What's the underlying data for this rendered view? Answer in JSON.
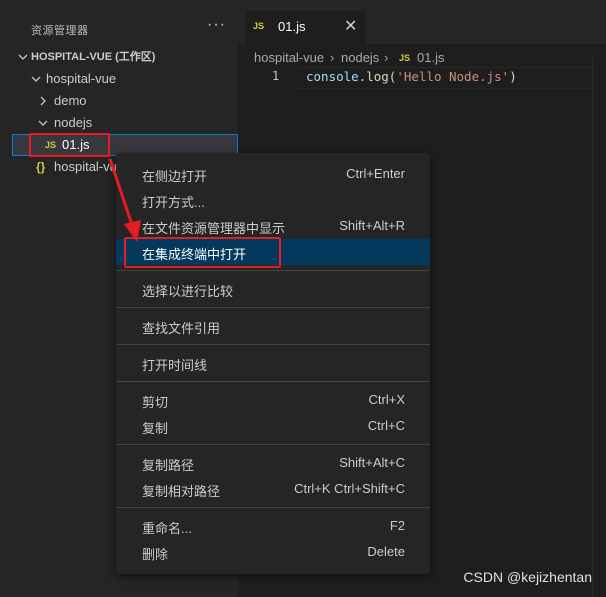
{
  "explorer": {
    "title": "资源管理器",
    "more": "···",
    "tree": [
      {
        "label": "HOSPITAL-VUE (工作区)",
        "chevron": "expanded"
      },
      {
        "label": "hospital-vue",
        "chevron": "expanded"
      },
      {
        "label": "demo",
        "chevron": "collapsed"
      },
      {
        "label": "nodejs",
        "chevron": "expanded"
      },
      {
        "label": "01.js",
        "icon_text": "JS",
        "selected": true
      },
      {
        "label": "hospital-vue.code-workspace",
        "icon_text": "{}"
      }
    ]
  },
  "editor": {
    "tab": {
      "icon_text": "JS",
      "label": "01.js",
      "close": "✕"
    },
    "breadcrumb": [
      "hospital-vue",
      "nodejs",
      "01.js"
    ],
    "breadcrumb_sep": "›",
    "breadcrumb_icon": "JS",
    "line_number": "1",
    "code_tokens": [
      "console",
      ".",
      "log",
      "(",
      "'Hello Node.js'",
      ")"
    ]
  },
  "context_menu": {
    "items": [
      {
        "label": "在侧边打开",
        "shortcut": "Ctrl+Enter"
      },
      {
        "label": "打开方式...",
        "shortcut": ""
      },
      {
        "label": "在文件资源管理器中显示",
        "shortcut": "Shift+Alt+R"
      },
      {
        "label": "在集成终端中打开",
        "shortcut": "",
        "active": true
      },
      {
        "label": "选择以进行比较",
        "shortcut": ""
      },
      {
        "label": "查找文件引用",
        "shortcut": ""
      },
      {
        "label": "打开时间线",
        "shortcut": ""
      },
      {
        "label": "剪切",
        "shortcut": "Ctrl+X"
      },
      {
        "label": "复制",
        "shortcut": "Ctrl+C"
      },
      {
        "label": "复制路径",
        "shortcut": "Shift+Alt+C"
      },
      {
        "label": "复制相对路径",
        "shortcut": "Ctrl+K Ctrl+Shift+C"
      },
      {
        "label": "重命名...",
        "shortcut": "F2"
      },
      {
        "label": "删除",
        "shortcut": "Delete"
      }
    ]
  },
  "watermark": "CSDN @kejizhentan",
  "colors": {
    "annotation_red": "#e51c23",
    "menu_active": "#04395e",
    "selection_outline": "#007fd4",
    "js_icon": "#cbcb41"
  }
}
